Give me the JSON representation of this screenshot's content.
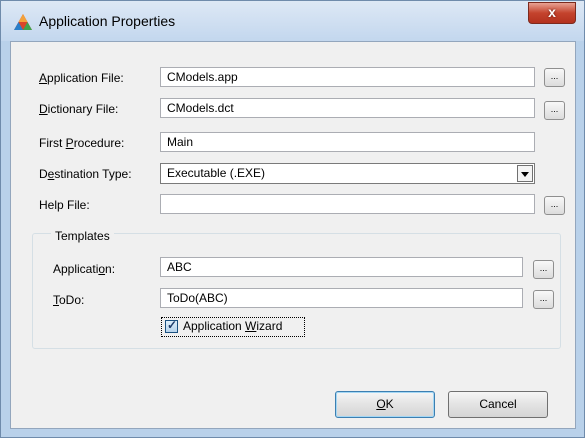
{
  "window": {
    "title": "Application Properties",
    "close_glyph": "x",
    "icon": "app-triangle-icon"
  },
  "fields": {
    "application_file": {
      "label_pre": "",
      "label_u": "A",
      "label_post": "pplication File:",
      "value": "CModels.app",
      "browse": "..."
    },
    "dictionary_file": {
      "label_pre": "",
      "label_u": "D",
      "label_post": "ictionary File:",
      "value": "CModels.dct",
      "browse": "..."
    },
    "first_procedure": {
      "label_pre": "First ",
      "label_u": "P",
      "label_post": "rocedure:",
      "value": "Main"
    },
    "destination_type": {
      "label_pre": "D",
      "label_u": "e",
      "label_post": "stination Type:",
      "value": "Executable (.EXE)"
    },
    "help_file": {
      "label_pre": "Help File:",
      "label_u": "",
      "label_post": "",
      "value": "",
      "browse": "..."
    }
  },
  "templates": {
    "group_title": "Templates",
    "application": {
      "label_pre": "Applicati",
      "label_u": "o",
      "label_post": "n:",
      "value": "ABC",
      "browse": "..."
    },
    "todo": {
      "label_pre": "",
      "label_u": "T",
      "label_post": "oDo:",
      "value": "ToDo(ABC)",
      "browse": "..."
    },
    "wizard": {
      "label_pre": "Application ",
      "label_u": "W",
      "label_post": "izard",
      "checked": true,
      "check_glyph": "✓"
    }
  },
  "buttons": {
    "ok_u": "O",
    "ok_post": "K",
    "cancel": "Cancel"
  }
}
